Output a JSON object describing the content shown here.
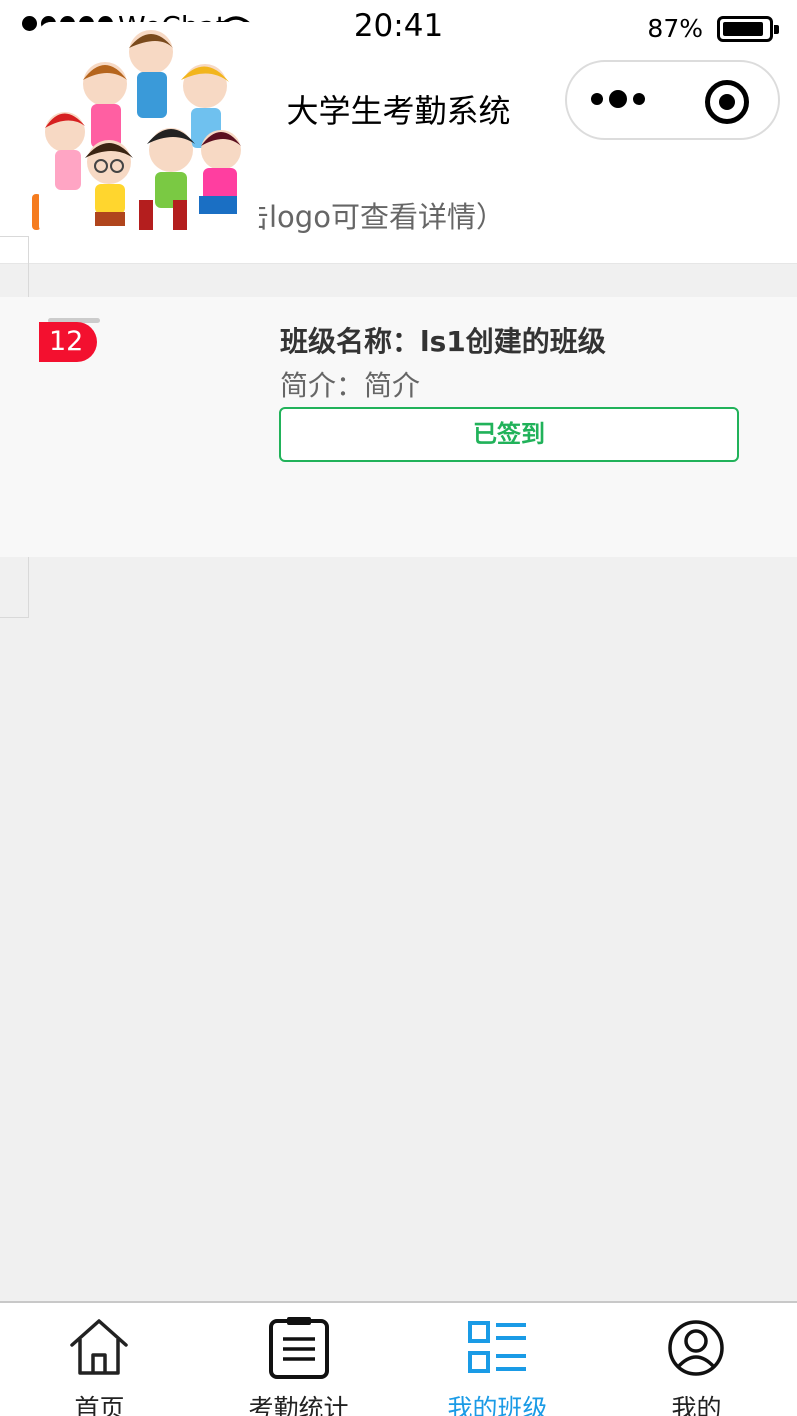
{
  "status_bar": {
    "carrier": "WeChat",
    "time": "20:41",
    "battery": "87%",
    "battery_level": 0.87
  },
  "navbar": {
    "title": "大学生考勤系统",
    "more_icon": "more-dots-icon",
    "close_icon": "target-close-icon"
  },
  "section": {
    "title": "班级列表（点击logo可查看详情）",
    "accent_color": "#f57c1f"
  },
  "class_card": {
    "badge": "12",
    "name": "班级名称：ls1创建的班级",
    "intro": "简介：简介",
    "checkin_label": "已签到",
    "checkin_color": "#21b25a",
    "badge_color": "#f3102f"
  },
  "tabbar": {
    "active_color": "#1a9be6",
    "items": [
      {
        "label": "首页",
        "icon": "home-icon"
      },
      {
        "label": "考勤统计",
        "icon": "clipboard-list-icon"
      },
      {
        "label": "我的班级",
        "icon": "grid-list-icon"
      },
      {
        "label": "我的",
        "icon": "user-profile-icon"
      }
    ]
  }
}
